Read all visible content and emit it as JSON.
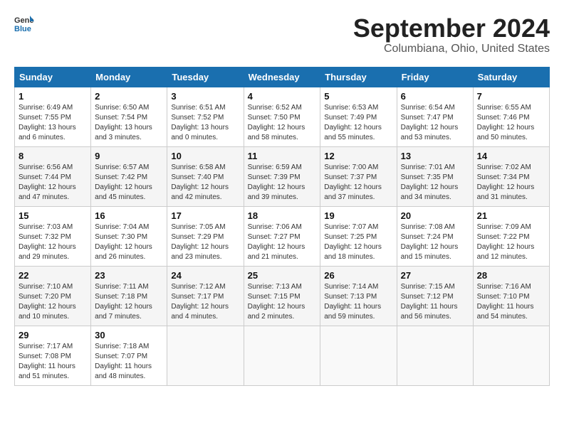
{
  "header": {
    "logo_general": "General",
    "logo_blue": "Blue",
    "month_title": "September 2024",
    "location": "Columbiana, Ohio, United States"
  },
  "calendar": {
    "weekdays": [
      "Sunday",
      "Monday",
      "Tuesday",
      "Wednesday",
      "Thursday",
      "Friday",
      "Saturday"
    ],
    "weeks": [
      [
        {
          "day": "1",
          "sunrise": "6:49 AM",
          "sunset": "7:55 PM",
          "daylight": "13 hours and 6 minutes."
        },
        {
          "day": "2",
          "sunrise": "6:50 AM",
          "sunset": "7:54 PM",
          "daylight": "13 hours and 3 minutes."
        },
        {
          "day": "3",
          "sunrise": "6:51 AM",
          "sunset": "7:52 PM",
          "daylight": "13 hours and 0 minutes."
        },
        {
          "day": "4",
          "sunrise": "6:52 AM",
          "sunset": "7:50 PM",
          "daylight": "12 hours and 58 minutes."
        },
        {
          "day": "5",
          "sunrise": "6:53 AM",
          "sunset": "7:49 PM",
          "daylight": "12 hours and 55 minutes."
        },
        {
          "day": "6",
          "sunrise": "6:54 AM",
          "sunset": "7:47 PM",
          "daylight": "12 hours and 53 minutes."
        },
        {
          "day": "7",
          "sunrise": "6:55 AM",
          "sunset": "7:46 PM",
          "daylight": "12 hours and 50 minutes."
        }
      ],
      [
        {
          "day": "8",
          "sunrise": "6:56 AM",
          "sunset": "7:44 PM",
          "daylight": "12 hours and 47 minutes."
        },
        {
          "day": "9",
          "sunrise": "6:57 AM",
          "sunset": "7:42 PM",
          "daylight": "12 hours and 45 minutes."
        },
        {
          "day": "10",
          "sunrise": "6:58 AM",
          "sunset": "7:40 PM",
          "daylight": "12 hours and 42 minutes."
        },
        {
          "day": "11",
          "sunrise": "6:59 AM",
          "sunset": "7:39 PM",
          "daylight": "12 hours and 39 minutes."
        },
        {
          "day": "12",
          "sunrise": "7:00 AM",
          "sunset": "7:37 PM",
          "daylight": "12 hours and 37 minutes."
        },
        {
          "day": "13",
          "sunrise": "7:01 AM",
          "sunset": "7:35 PM",
          "daylight": "12 hours and 34 minutes."
        },
        {
          "day": "14",
          "sunrise": "7:02 AM",
          "sunset": "7:34 PM",
          "daylight": "12 hours and 31 minutes."
        }
      ],
      [
        {
          "day": "15",
          "sunrise": "7:03 AM",
          "sunset": "7:32 PM",
          "daylight": "12 hours and 29 minutes."
        },
        {
          "day": "16",
          "sunrise": "7:04 AM",
          "sunset": "7:30 PM",
          "daylight": "12 hours and 26 minutes."
        },
        {
          "day": "17",
          "sunrise": "7:05 AM",
          "sunset": "7:29 PM",
          "daylight": "12 hours and 23 minutes."
        },
        {
          "day": "18",
          "sunrise": "7:06 AM",
          "sunset": "7:27 PM",
          "daylight": "12 hours and 21 minutes."
        },
        {
          "day": "19",
          "sunrise": "7:07 AM",
          "sunset": "7:25 PM",
          "daylight": "12 hours and 18 minutes."
        },
        {
          "day": "20",
          "sunrise": "7:08 AM",
          "sunset": "7:24 PM",
          "daylight": "12 hours and 15 minutes."
        },
        {
          "day": "21",
          "sunrise": "7:09 AM",
          "sunset": "7:22 PM",
          "daylight": "12 hours and 12 minutes."
        }
      ],
      [
        {
          "day": "22",
          "sunrise": "7:10 AM",
          "sunset": "7:20 PM",
          "daylight": "12 hours and 10 minutes."
        },
        {
          "day": "23",
          "sunrise": "7:11 AM",
          "sunset": "7:18 PM",
          "daylight": "12 hours and 7 minutes."
        },
        {
          "day": "24",
          "sunrise": "7:12 AM",
          "sunset": "7:17 PM",
          "daylight": "12 hours and 4 minutes."
        },
        {
          "day": "25",
          "sunrise": "7:13 AM",
          "sunset": "7:15 PM",
          "daylight": "12 hours and 2 minutes."
        },
        {
          "day": "26",
          "sunrise": "7:14 AM",
          "sunset": "7:13 PM",
          "daylight": "11 hours and 59 minutes."
        },
        {
          "day": "27",
          "sunrise": "7:15 AM",
          "sunset": "7:12 PM",
          "daylight": "11 hours and 56 minutes."
        },
        {
          "day": "28",
          "sunrise": "7:16 AM",
          "sunset": "7:10 PM",
          "daylight": "11 hours and 54 minutes."
        }
      ],
      [
        {
          "day": "29",
          "sunrise": "7:17 AM",
          "sunset": "7:08 PM",
          "daylight": "11 hours and 51 minutes."
        },
        {
          "day": "30",
          "sunrise": "7:18 AM",
          "sunset": "7:07 PM",
          "daylight": "11 hours and 48 minutes."
        },
        {
          "day": "",
          "sunrise": "",
          "sunset": "",
          "daylight": ""
        },
        {
          "day": "",
          "sunrise": "",
          "sunset": "",
          "daylight": ""
        },
        {
          "day": "",
          "sunrise": "",
          "sunset": "",
          "daylight": ""
        },
        {
          "day": "",
          "sunrise": "",
          "sunset": "",
          "daylight": ""
        },
        {
          "day": "",
          "sunrise": "",
          "sunset": "",
          "daylight": ""
        }
      ]
    ]
  },
  "labels": {
    "sunrise_prefix": "Sunrise: ",
    "sunset_prefix": "Sunset: ",
    "daylight_prefix": "Daylight: "
  }
}
